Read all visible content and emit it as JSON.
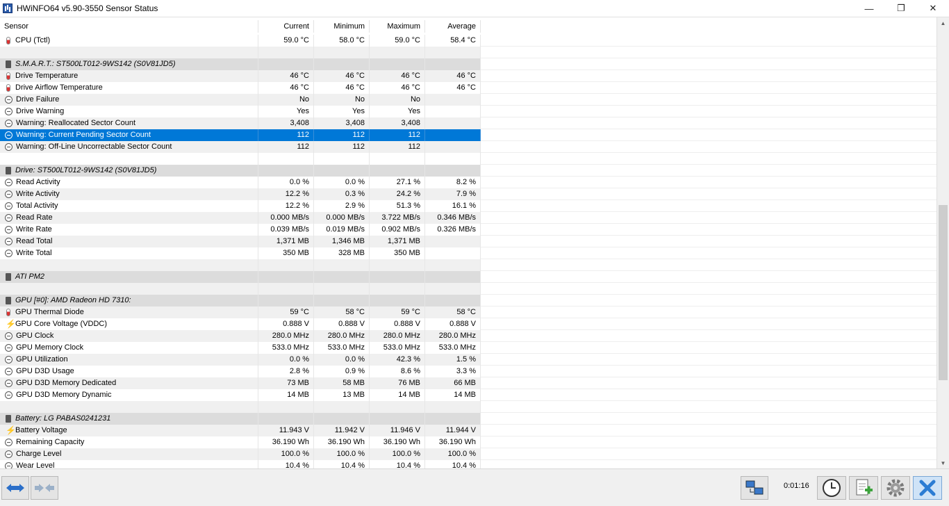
{
  "window": {
    "title": "HWiNFO64 v5.90-3550 Sensor Status",
    "minimize_glyph": "—",
    "maximize_glyph": "❐",
    "close_glyph": "✕"
  },
  "columns": [
    "Sensor",
    "Current",
    "Minimum",
    "Maximum",
    "Average"
  ],
  "rows": [
    {
      "type": "sensor",
      "icon": "thermometer-icon",
      "name": "CPU (Tctl)",
      "current": "59.0 °C",
      "minimum": "58.0 °C",
      "maximum": "59.0 °C",
      "average": "58.4 °C"
    },
    {
      "type": "blank"
    },
    {
      "type": "group",
      "icon": "chip-icon",
      "name": "S.M.A.R.T.: ST500LT012-9WS142 (S0V81JD5)"
    },
    {
      "type": "sensor",
      "icon": "thermometer-icon",
      "name": "Drive Temperature",
      "current": "46 °C",
      "minimum": "46 °C",
      "maximum": "46 °C",
      "average": "46 °C"
    },
    {
      "type": "sensor",
      "icon": "thermometer-icon",
      "name": "Drive Airflow Temperature",
      "current": "46 °C",
      "minimum": "46 °C",
      "maximum": "46 °C",
      "average": "46 °C"
    },
    {
      "type": "sensor",
      "icon": "circle-icon",
      "name": "Drive Failure",
      "current": "No",
      "minimum": "No",
      "maximum": "No",
      "average": ""
    },
    {
      "type": "sensor",
      "icon": "circle-icon",
      "name": "Drive Warning",
      "current": "Yes",
      "minimum": "Yes",
      "maximum": "Yes",
      "average": ""
    },
    {
      "type": "sensor",
      "icon": "circle-icon",
      "name": "Warning: Reallocated Sector Count",
      "current": "3,408",
      "minimum": "3,408",
      "maximum": "3,408",
      "average": ""
    },
    {
      "type": "sensor",
      "icon": "circle-icon",
      "name": "Warning: Current Pending Sector Count",
      "current": "112",
      "minimum": "112",
      "maximum": "112",
      "average": "",
      "selected": true
    },
    {
      "type": "sensor",
      "icon": "circle-icon",
      "name": "Warning: Off-Line Uncorrectable Sector Count",
      "current": "112",
      "minimum": "112",
      "maximum": "112",
      "average": ""
    },
    {
      "type": "blank"
    },
    {
      "type": "group",
      "icon": "chip-icon",
      "name": "Drive: ST500LT012-9WS142 (S0V81JD5)"
    },
    {
      "type": "sensor",
      "icon": "circle-icon",
      "name": "Read Activity",
      "current": "0.0 %",
      "minimum": "0.0 %",
      "maximum": "27.1 %",
      "average": "8.2 %"
    },
    {
      "type": "sensor",
      "icon": "circle-icon",
      "name": "Write Activity",
      "current": "12.2 %",
      "minimum": "0.3 %",
      "maximum": "24.2 %",
      "average": "7.9 %"
    },
    {
      "type": "sensor",
      "icon": "circle-icon",
      "name": "Total Activity",
      "current": "12.2 %",
      "minimum": "2.9 %",
      "maximum": "51.3 %",
      "average": "16.1 %"
    },
    {
      "type": "sensor",
      "icon": "circle-icon",
      "name": "Read Rate",
      "current": "0.000 MB/s",
      "minimum": "0.000 MB/s",
      "maximum": "3.722 MB/s",
      "average": "0.346 MB/s"
    },
    {
      "type": "sensor",
      "icon": "circle-icon",
      "name": "Write Rate",
      "current": "0.039 MB/s",
      "minimum": "0.019 MB/s",
      "maximum": "0.902 MB/s",
      "average": "0.326 MB/s"
    },
    {
      "type": "sensor",
      "icon": "circle-icon",
      "name": "Read Total",
      "current": "1,371 MB",
      "minimum": "1,346 MB",
      "maximum": "1,371 MB",
      "average": ""
    },
    {
      "type": "sensor",
      "icon": "circle-icon",
      "name": "Write Total",
      "current": "350 MB",
      "minimum": "328 MB",
      "maximum": "350 MB",
      "average": ""
    },
    {
      "type": "blank"
    },
    {
      "type": "group",
      "icon": "chip-icon",
      "name": "ATI PM2"
    },
    {
      "type": "blank"
    },
    {
      "type": "group",
      "icon": "chip-icon",
      "name": "GPU [#0]: AMD Radeon HD 7310:"
    },
    {
      "type": "sensor",
      "icon": "thermometer-icon",
      "name": "GPU Thermal Diode",
      "current": "59 °C",
      "minimum": "58 °C",
      "maximum": "59 °C",
      "average": "58 °C"
    },
    {
      "type": "sensor",
      "icon": "bolt-icon",
      "name": "GPU Core Voltage (VDDC)",
      "current": "0.888 V",
      "minimum": "0.888 V",
      "maximum": "0.888 V",
      "average": "0.888 V"
    },
    {
      "type": "sensor",
      "icon": "circle-icon",
      "name": "GPU Clock",
      "current": "280.0 MHz",
      "minimum": "280.0 MHz",
      "maximum": "280.0 MHz",
      "average": "280.0 MHz"
    },
    {
      "type": "sensor",
      "icon": "circle-icon",
      "name": "GPU Memory Clock",
      "current": "533.0 MHz",
      "minimum": "533.0 MHz",
      "maximum": "533.0 MHz",
      "average": "533.0 MHz"
    },
    {
      "type": "sensor",
      "icon": "circle-icon",
      "name": "GPU Utilization",
      "current": "0.0 %",
      "minimum": "0.0 %",
      "maximum": "42.3 %",
      "average": "1.5 %"
    },
    {
      "type": "sensor",
      "icon": "circle-icon",
      "name": "GPU D3D Usage",
      "current": "2.8 %",
      "minimum": "0.9 %",
      "maximum": "8.6 %",
      "average": "3.3 %"
    },
    {
      "type": "sensor",
      "icon": "circle-icon",
      "name": "GPU D3D Memory Dedicated",
      "current": "73 MB",
      "minimum": "58 MB",
      "maximum": "76 MB",
      "average": "66 MB"
    },
    {
      "type": "sensor",
      "icon": "circle-icon",
      "name": "GPU D3D Memory Dynamic",
      "current": "14 MB",
      "minimum": "13 MB",
      "maximum": "14 MB",
      "average": "14 MB"
    },
    {
      "type": "blank"
    },
    {
      "type": "group",
      "icon": "chip-icon",
      "name": "Battery: LG PABAS0241231"
    },
    {
      "type": "sensor",
      "icon": "bolt-icon",
      "name": "Battery Voltage",
      "current": "11.943 V",
      "minimum": "11.942 V",
      "maximum": "11.946 V",
      "average": "11.944 V"
    },
    {
      "type": "sensor",
      "icon": "circle-icon",
      "name": "Remaining Capacity",
      "current": "36.190 Wh",
      "minimum": "36.190 Wh",
      "maximum": "36.190 Wh",
      "average": "36.190 Wh"
    },
    {
      "type": "sensor",
      "icon": "circle-icon",
      "name": "Charge Level",
      "current": "100.0 %",
      "minimum": "100.0 %",
      "maximum": "100.0 %",
      "average": "100.0 %"
    },
    {
      "type": "sensor",
      "icon": "circle-icon",
      "name": "Wear Level",
      "current": "10.4 %",
      "minimum": "10.4 %",
      "maximum": "10.4 %",
      "average": "10.4 %"
    }
  ],
  "toolbar": {
    "elapsed_time": "0:01:16"
  },
  "colors": {
    "selection": "#0078d7",
    "group_row": "#dcdcdc",
    "alt_row": "#f0f0f0",
    "close_button": "#2b7cd3"
  }
}
